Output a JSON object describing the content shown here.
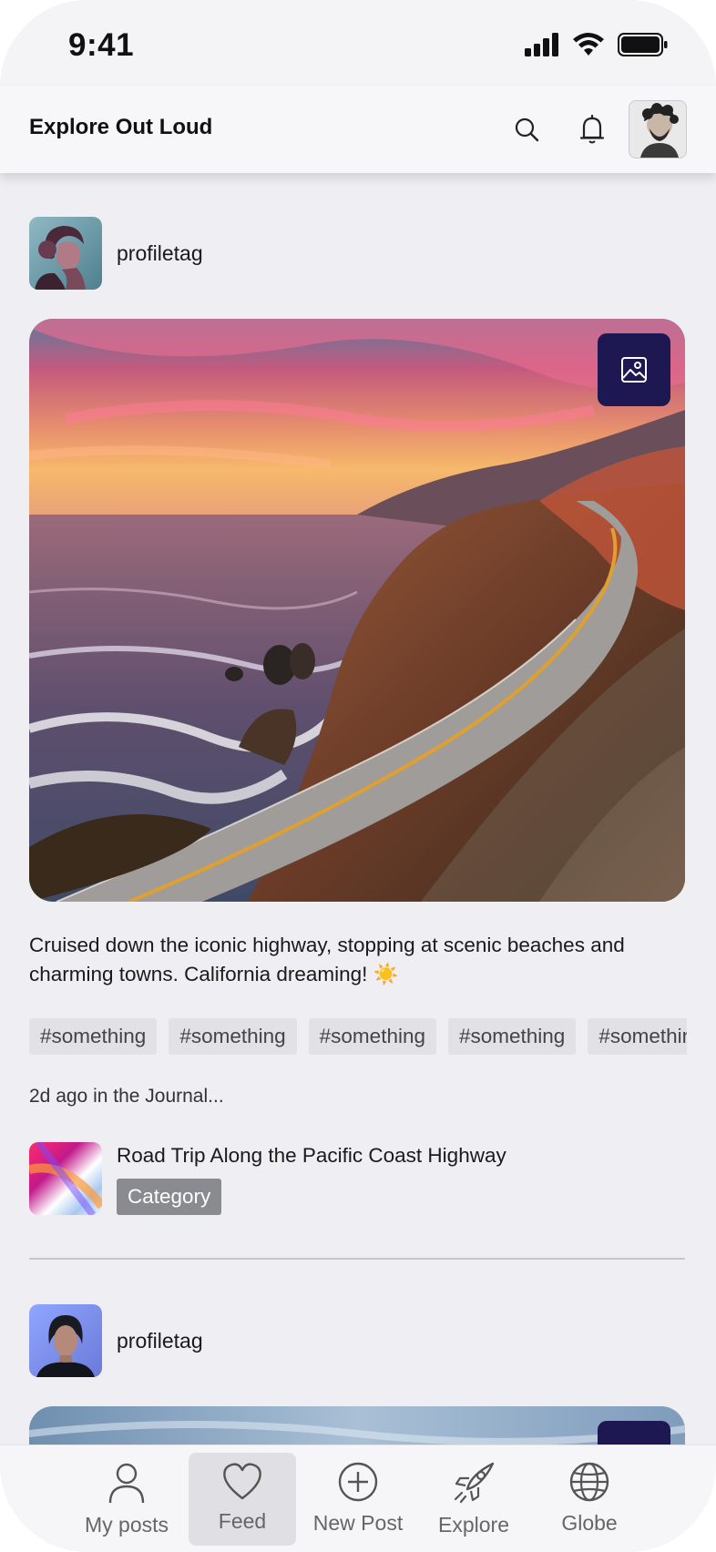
{
  "status": {
    "time": "9:41"
  },
  "header": {
    "title": "Explore Out Loud"
  },
  "posts": [
    {
      "user": "profiletag",
      "caption": "Cruised down the iconic highway, stopping at scenic beaches and charming towns. California dreaming! ☀️",
      "tags": [
        "#something",
        "#something",
        "#something",
        "#something",
        "#something"
      ],
      "journal_time": "2d ago in the Journal...",
      "journal_title": "Road Trip Along the Pacific Coast Highway",
      "journal_category": "Category"
    },
    {
      "user": "profiletag"
    }
  ],
  "tabs": [
    {
      "label": "My posts",
      "icon": "person-icon"
    },
    {
      "label": "Feed",
      "icon": "heart-icon",
      "active": true
    },
    {
      "label": "New Post",
      "icon": "plus-circle-icon"
    },
    {
      "label": "Explore",
      "icon": "rocket-icon"
    },
    {
      "label": "Globe",
      "icon": "globe-icon"
    }
  ],
  "colors": {
    "accent_badge": "#1d1752",
    "background": "#efeff3",
    "category": "#8a8a91"
  }
}
